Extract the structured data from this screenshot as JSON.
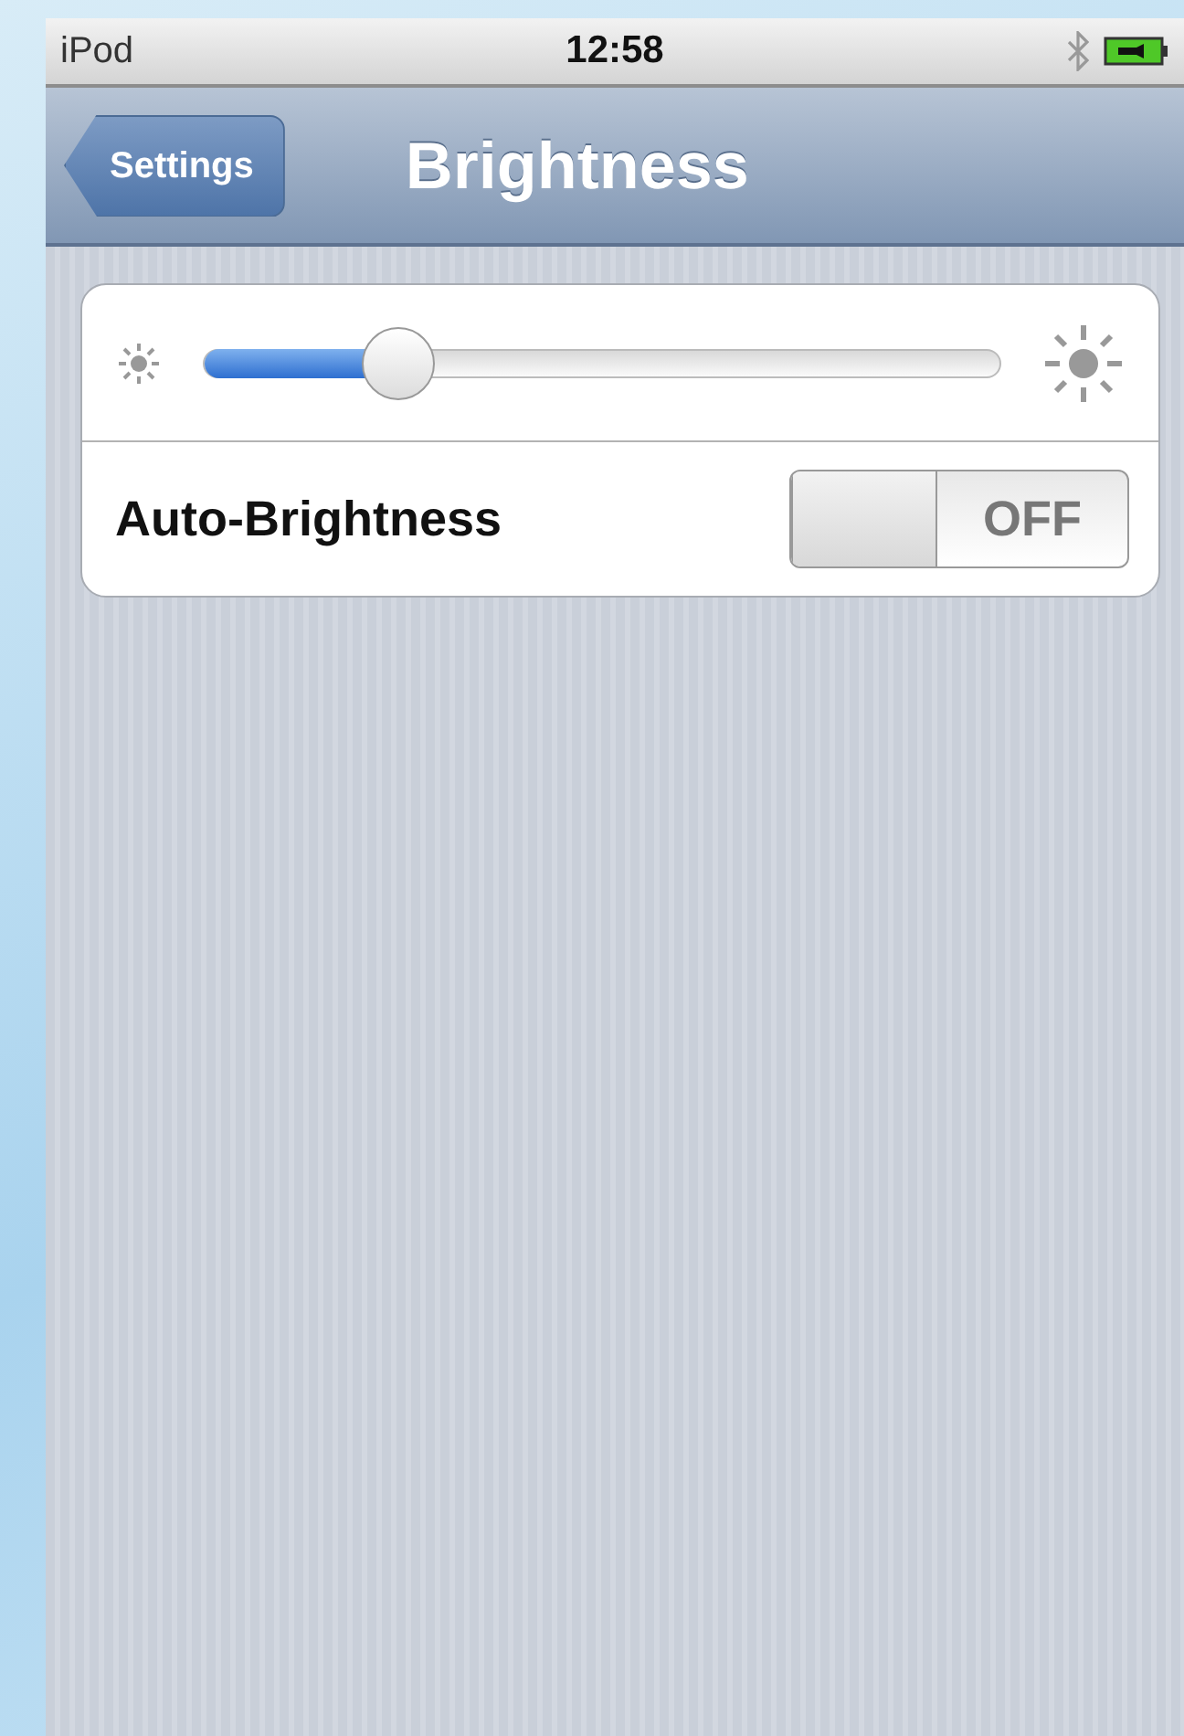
{
  "status_bar": {
    "carrier": "iPod",
    "time": "12:58"
  },
  "nav_bar": {
    "back_button": "Settings",
    "title": "Brightness"
  },
  "brightness": {
    "level": 0.22
  },
  "auto_brightness": {
    "label": "Auto-Brightness",
    "on": false,
    "switch_text": "OFF"
  }
}
